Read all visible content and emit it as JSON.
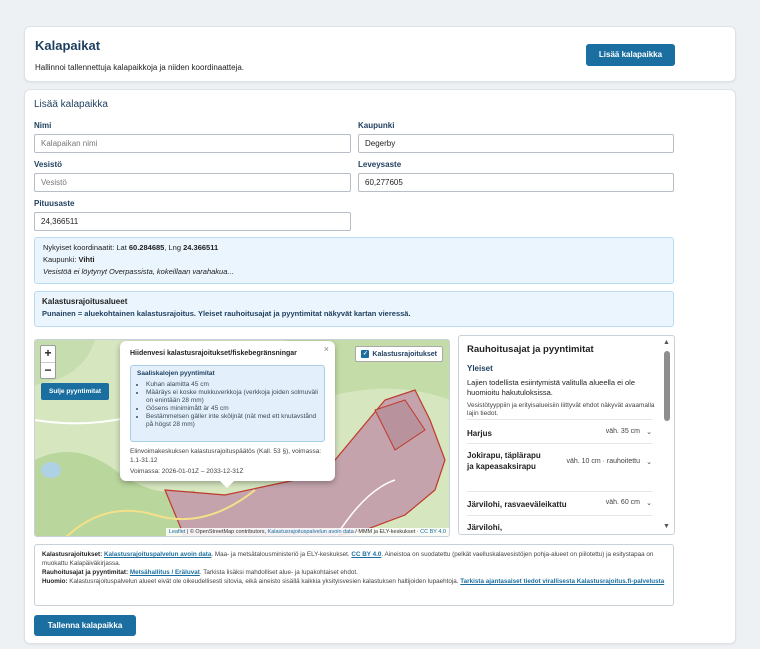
{
  "header": {
    "title": "Kalapaikat",
    "subtitle": "Hallinnoi tallennettuja kalapaikkoja ja niiden koordinaatteja.",
    "add_button": "Lisää kalapaikka"
  },
  "form": {
    "title": "Lisää kalapaikka",
    "fields": {
      "name": {
        "label": "Nimi",
        "placeholder": "Kalapaikan nimi",
        "value": ""
      },
      "city": {
        "label": "Kaupunki",
        "value": "Degerby"
      },
      "water": {
        "label": "Vesistö",
        "placeholder": "Vesistö",
        "value": ""
      },
      "lat": {
        "label": "Leveysaste",
        "value": "60,277605"
      },
      "lng": {
        "label": "Pituusaste",
        "value": "24,366511"
      }
    }
  },
  "coords_info": {
    "current_prefix": "Nykyiset koordinaatit: Lat ",
    "lat": "60.284685",
    "lng_sep": ", Lng ",
    "lng": "24.366511",
    "city_prefix": "Kaupunki: ",
    "city": "Vihti",
    "water_note": "Vesistöä ei löytynyt Overpassista, kokeillaan varahakua..."
  },
  "restrictions": {
    "title": "Kalastusrajoitusalueet",
    "text": "Punainen = aluekohtainen kalastusrajoitus. Yleiset rauhoitusajat ja pyyntimitat näkyvät kartan vieressä."
  },
  "map": {
    "zoom_in": "+",
    "zoom_out": "−",
    "close_limits_button": "Sulje pyyntimitat",
    "layer_toggle": "Kalastusrajoitukset",
    "popup": {
      "title": "Hiidenvesi kalastusrajoitukset/fiskebegränsningar",
      "inner_title": "Saaliskalojen pyyntimitat",
      "bullets": [
        "Kuhan alamitta 45 cm",
        "Määräys ei koske mukkuverkkoja (verkkoja joiden solmuväli on enintään 28 mm)",
        "Gösens minimimått är 45 cm",
        "Bestämmelsen gäller inte sköljnät (nät med ett knutavstånd på högst 28 mm)"
      ],
      "decision": "Elinvoimakeskuksen kalastusrajoituspäätös (Kall. 53 §), voimassa: 1.1-31.12",
      "validity": "Voimassa: 2026-01-01Z – 2033-12-31Z"
    },
    "attribution_leaflet": "Leaflet",
    "attribution_osm": " | © OpenStreetMap contributors, ",
    "attribution_link": "Kalastusrajoituspalvelun avoin data",
    "attribution_tail": " / MMM ja ELY-keskukset · ",
    "attribution_license": "CC BY 4.0"
  },
  "side_panel": {
    "title": "Rauhoitusajat ja pyyntimitat",
    "subtitle": "Yleiset",
    "text": "Lajien todellista esiintymistä valitulla alueella ei ole huomioitu hakutuloksissa.",
    "note": "Vesistötyyppiin ja erityisalueisiin liittyvät ehdot näkyvät avaamalla lajin tiedot.",
    "rows": [
      {
        "name": "Harjus",
        "value": "väh. 35 cm"
      },
      {
        "name": "Jokirapu, täplärapu ja kapeasaksirapu",
        "value": "väh. 10 cm · rauhoitettu"
      },
      {
        "name": "Järvilohi, rasvaeväleikattu",
        "value": "väh. 60 cm"
      },
      {
        "name": "Järvilohi,",
        "value": ""
      }
    ]
  },
  "sources": {
    "line1_label": "Kalastusrajoitukset:",
    "line1_link": "Kalastusrajoituspalvelun avoin data",
    "line1_text": ". Maa- ja metsätalousministeriö ja ELY-keskukset.",
    "line1_license": "CC BY 4.0",
    "line1_tail": ". Aineistoa on suodatettu (pelkät vaelluskalavesistöjen pohja-alueet on piilotettu) ja esitystapaa on muokattu Kalapäiväkirjassa.",
    "line2_label": "Rauhoitusajat ja pyyntimitat:",
    "line2_link": "Metsähallitus / Eräluvat",
    "line2_text": ". Tarkista lisäksi mahdolliset alue- ja lupakohtaiset ehdot.",
    "line3_label": "Huomio:",
    "line3_text": "Kalastusrajoituspalvelun alueet eivät ole oikeudellisesti sitovia, eikä aineisto sisällä kaikkia yksityisvesien kalastuksen haltijoiden lupaehtoja.",
    "line3_link": "Tarkista ajantasaiset tiedot virallisesta Kalastusrajoitus.fi-palvelusta"
  },
  "save_button": "Tallenna kalapaikka"
}
